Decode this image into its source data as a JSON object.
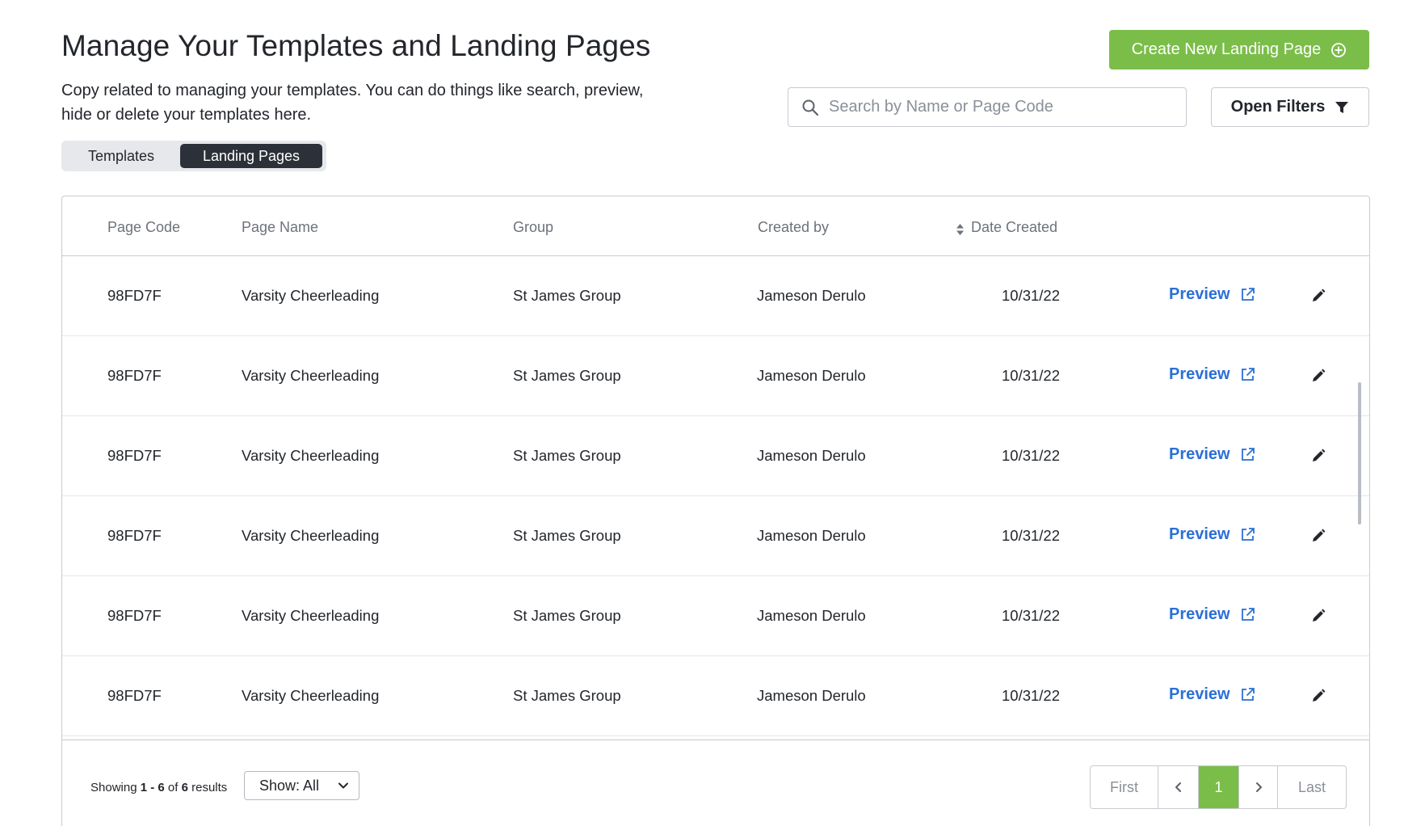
{
  "header": {
    "title": "Manage Your Templates and Landing Pages",
    "description": "Copy related to managing your templates. You can do things like search, preview, hide or delete your templates here.",
    "create_label": "Create New Landing Page"
  },
  "tabs": [
    {
      "label": "Templates",
      "active": false
    },
    {
      "label": "Landing Pages",
      "active": true
    }
  ],
  "search": {
    "placeholder": "Search by Name or Page Code",
    "value": ""
  },
  "filters_label": "Open Filters",
  "table": {
    "columns": [
      "Page Code",
      "Page Name",
      "Group",
      "Created by",
      "Date Created"
    ],
    "preview_label": "Preview",
    "rows": [
      {
        "code": "98FD7F",
        "name": "Varsity Cheerleading",
        "group": "St James Group",
        "created_by": "Jameson Derulo",
        "date": "10/31/22"
      },
      {
        "code": "98FD7F",
        "name": "Varsity Cheerleading",
        "group": "St James Group",
        "created_by": "Jameson Derulo",
        "date": "10/31/22"
      },
      {
        "code": "98FD7F",
        "name": "Varsity Cheerleading",
        "group": "St James Group",
        "created_by": "Jameson Derulo",
        "date": "10/31/22"
      },
      {
        "code": "98FD7F",
        "name": "Varsity Cheerleading",
        "group": "St James Group",
        "created_by": "Jameson Derulo",
        "date": "10/31/22"
      },
      {
        "code": "98FD7F",
        "name": "Varsity Cheerleading",
        "group": "St James Group",
        "created_by": "Jameson Derulo",
        "date": "10/31/22"
      },
      {
        "code": "98FD7F",
        "name": "Varsity Cheerleading",
        "group": "St James Group",
        "created_by": "Jameson Derulo",
        "date": "10/31/22"
      }
    ]
  },
  "footer": {
    "showing_prefix": "Showing",
    "range": "1 - 6",
    "of_text": "of",
    "total": "6",
    "results_text": "results",
    "show_select": "Show: All"
  },
  "pagination": {
    "first": "First",
    "current": "1",
    "last": "Last"
  },
  "colors": {
    "accent_green": "#7bbd49",
    "link_blue": "#2b6fd6",
    "dark_tab": "#2c3039",
    "border": "#c7cbd1"
  },
  "icons": {
    "create": "plus-circle-icon",
    "search": "search-icon",
    "filter": "filter-icon",
    "sort": "sort-icon",
    "preview": "external-link-icon",
    "edit": "pencil-icon",
    "select": "chevron-down-icon",
    "prev": "chevron-left-icon",
    "next": "chevron-right-icon"
  }
}
